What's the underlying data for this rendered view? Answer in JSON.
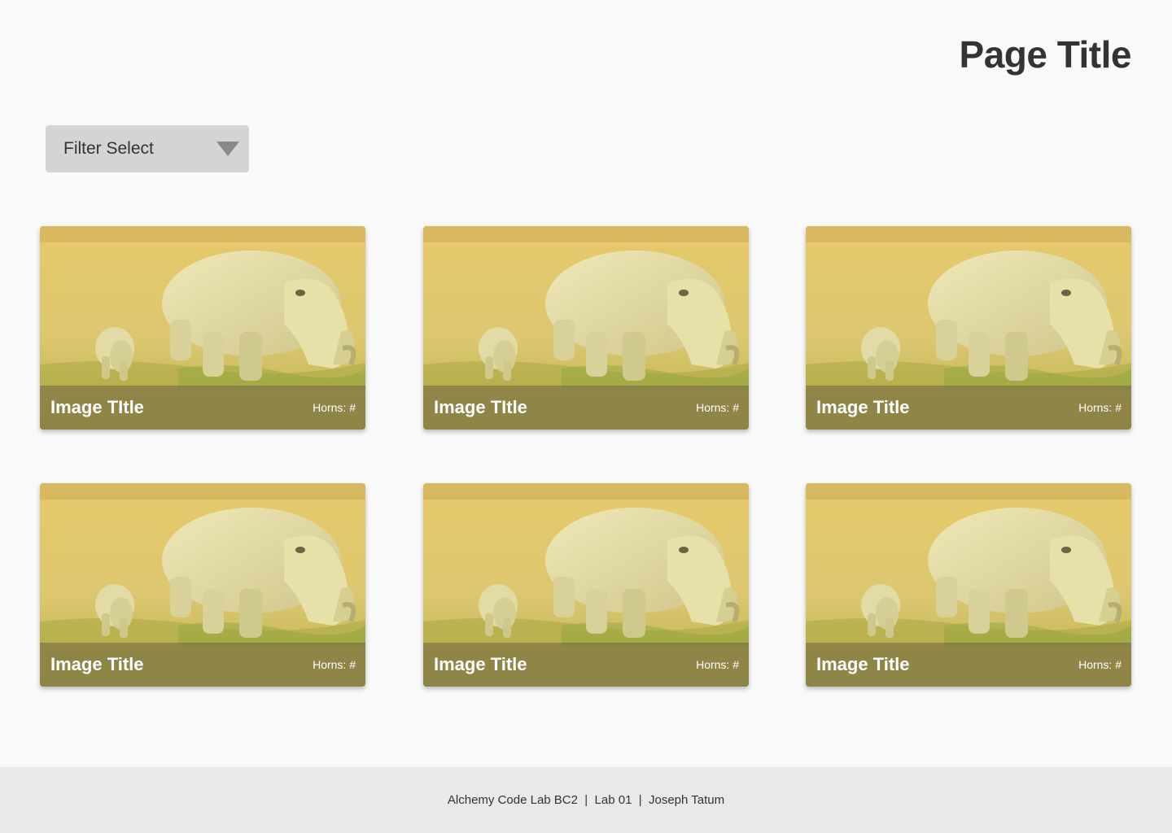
{
  "header": {
    "title": "Page Title"
  },
  "filter": {
    "label": "Filter Select",
    "icon": "triangle-down-icon"
  },
  "cards": [
    {
      "title": "Image TItle",
      "horns": "Horns: #"
    },
    {
      "title": "Image TItle",
      "horns": "Horns: #"
    },
    {
      "title": "Image Title",
      "horns": "Horns: #"
    },
    {
      "title": "Image Title",
      "horns": "Horns: #"
    },
    {
      "title": "Image Title",
      "horns": "Horns: #"
    },
    {
      "title": "Image Title",
      "horns": "Horns: #"
    }
  ],
  "footer": {
    "text": "Alchemy Code Lab BC2  |  Lab 01  |  Joseph Tatum"
  },
  "colors": {
    "background": "#f9f9f9",
    "filter_bg": "#d4d4d4",
    "footer_bg": "#e9e9e9",
    "title_text": "#333333"
  }
}
